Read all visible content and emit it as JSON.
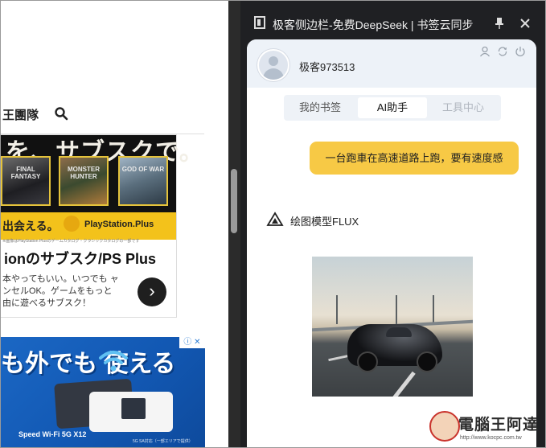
{
  "left_page": {
    "nav_text": "王團隊",
    "ad1": {
      "banner": "を、サブスクで。",
      "games": [
        "FINAL FANTASY",
        "MONSTER HUNTER",
        "GOD OF WAR"
      ],
      "yellow_text": "出会える。",
      "ps_plus": "PlayStation.Plus",
      "fine_print": "※画像はPlayStation Plusのゲームカタログ・クラシックカタログの一部です",
      "title": "ionのサブスク/PS Plus",
      "desc": "本やってもいい。いつでも ャンセルOK。ゲームをもっと 由に遊べるサブスク！",
      "arrow": "›"
    },
    "ad2": {
      "headline": "も外でも 使える",
      "adchoices": "ⓘ ✕",
      "caption": "Speed Wi-Fi 5G X12",
      "fine": "5G SA対応（一部エリアで提供）"
    }
  },
  "sidebar": {
    "title": "极客侧边栏-免费DeepSeek | 书签云同步",
    "username": "极客973513",
    "tabs": [
      {
        "label": "我的书签"
      },
      {
        "label": "AI助手"
      },
      {
        "label": "工具中心"
      }
    ],
    "user_message": "一台跑車在高速道路上跑，要有速度感",
    "model_name": "绘图模型FLUX"
  },
  "watermark": {
    "title": "電腦王阿達",
    "url": "http://www.kocpc.com.tw"
  },
  "colors": {
    "sidebar_bg": "#1f2023",
    "bubble": "#f7c945",
    "panel_head": "#edf2f8",
    "ad_yellow": "#f3c21b",
    "ad_blue": "#1b67c4"
  }
}
